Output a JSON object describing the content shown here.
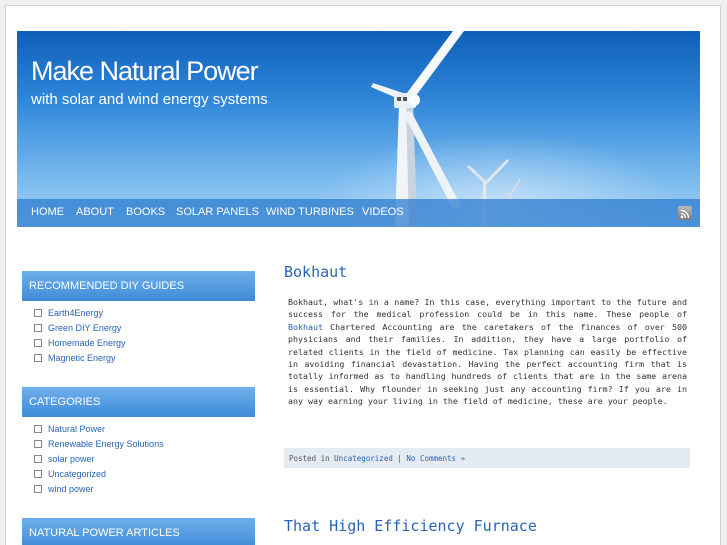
{
  "header": {
    "site_title": "Make Natural Power",
    "tagline": "with solar and wind energy systems"
  },
  "nav": {
    "items": [
      "HOME",
      "ABOUT",
      "BOOKS",
      "SOLAR PANELS",
      "WIND TURBINES",
      "VIDEOS"
    ]
  },
  "sidebar": {
    "widgets": [
      {
        "title": "RECOMMENDED DIY GUIDES",
        "items": [
          "Earth4Energy",
          "Green DIY Energy",
          "Homemade Energy",
          "Magnetic Energy"
        ]
      },
      {
        "title": "CATEGORIES",
        "items": [
          "Natural Power",
          "Renewable Energy Solutions",
          "solar power",
          "Uncategorized",
          "wind power"
        ]
      },
      {
        "title": "NATURAL POWER ARTICLES",
        "items": []
      }
    ]
  },
  "posts": [
    {
      "title": "Bokhaut",
      "body_before": "Bokhaut, what's in a name? In this case, everything important to the future and success for the medical profession could be in this name. These people of ",
      "body_link": "Bokhaut",
      "body_after": " Chartered Accounting are the caretakers of the finances of over 500 physicians and their families. In addition, they have a large portfolio of related clients in the field of medicine. Tax planning can easily be effective in avoiding financial devastation. Having the perfect accounting firm that is totally informed as to handling hundreds of clients that are in the same arena is essential. Why flounder in seeking just any accounting firm? If you are in any way earning your living in the field of medicine, these are your people.",
      "meta_prefix": "Posted in ",
      "meta_category": "Uncategorized",
      "meta_separator": " | ",
      "meta_comments": "No Comments »"
    },
    {
      "title": "That High Efficiency Furnace"
    }
  ],
  "icons": {
    "feed": "rss-icon",
    "list_item": "checkbox-icon"
  },
  "colors": {
    "accent": "#2a64b4",
    "nav_bar": "#2878cd",
    "widget_title": "#4f9be0",
    "meta_bar": "#e4ebf3"
  }
}
